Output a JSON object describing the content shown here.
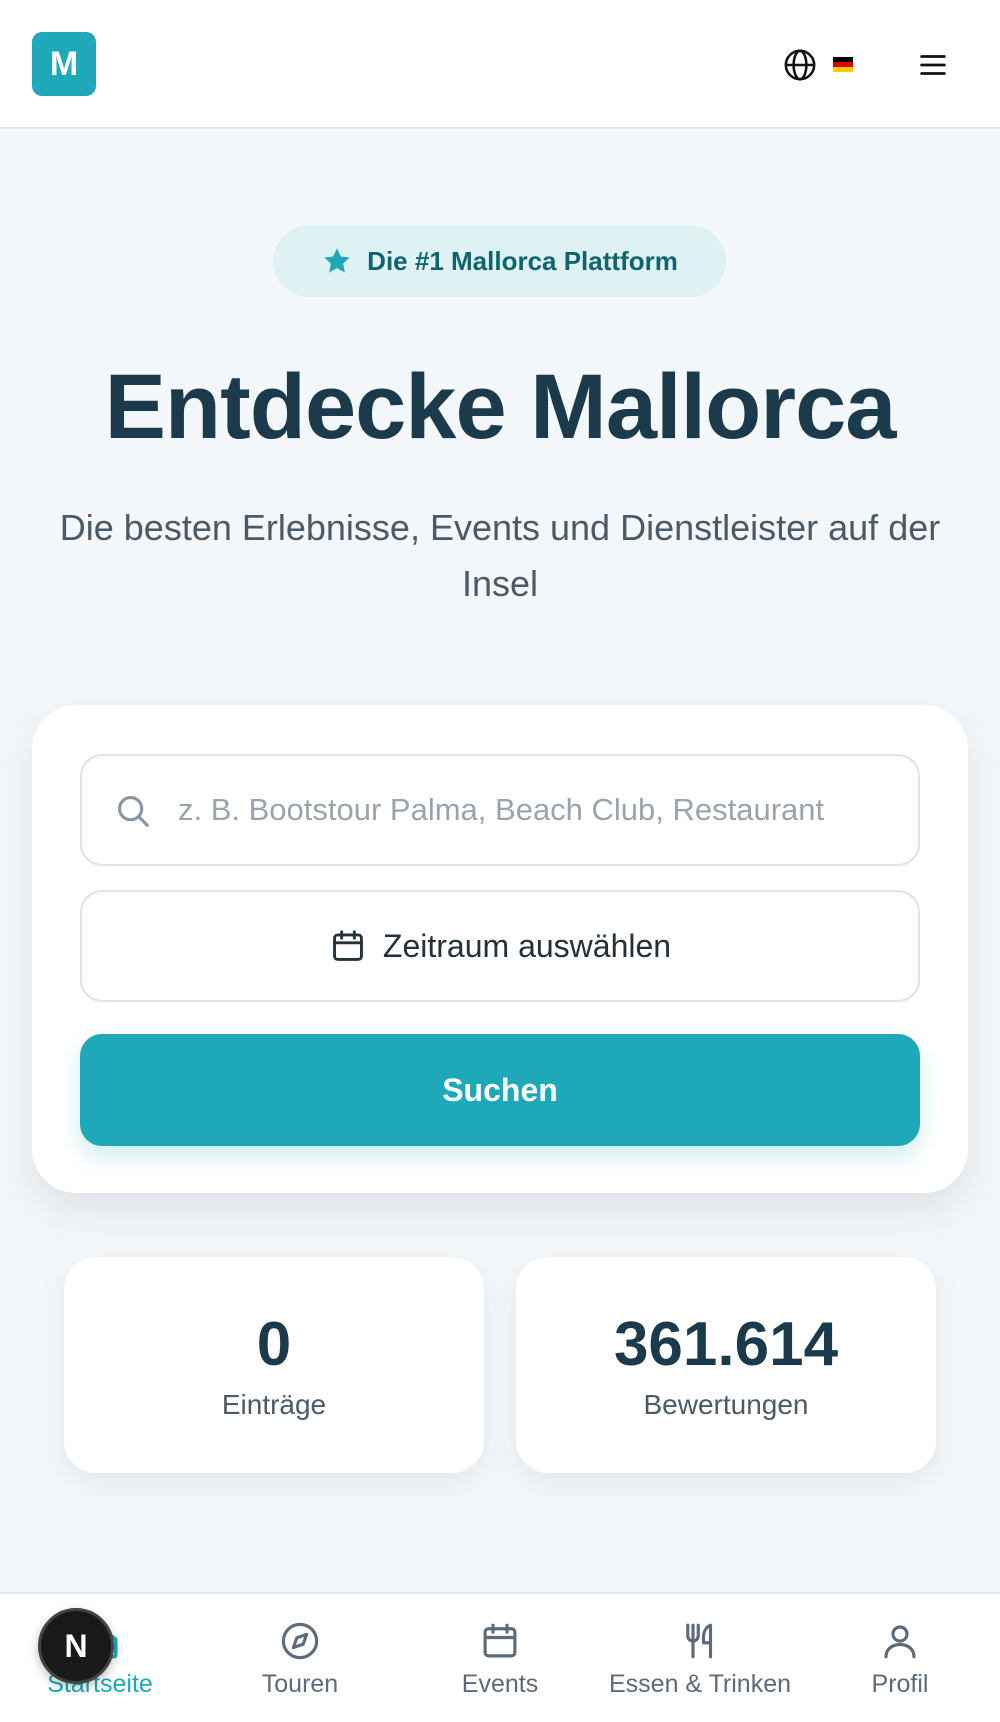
{
  "header": {
    "logo_letter": "M",
    "language_flag": "de",
    "icons": {
      "language": "globe-icon",
      "menu": "menu-icon"
    }
  },
  "hero": {
    "badge_text": "Die #1 Mallorca Plattform",
    "title": "Entdecke Mallorca",
    "subtitle": "Die besten Erlebnisse, Events und Dienstleister auf der Insel"
  },
  "search": {
    "placeholder": "z. B. Bootstour Palma, Beach Club, Restaurant",
    "value": "",
    "date_label": "Zeitraum auswählen",
    "submit_label": "Suchen"
  },
  "stats": [
    {
      "value": "0",
      "label": "Einträge"
    },
    {
      "value": "361.614",
      "label": "Bewertungen"
    }
  ],
  "bottom_nav": {
    "items": [
      {
        "label": "Startseite",
        "icon": "home-icon",
        "active": true
      },
      {
        "label": "Touren",
        "icon": "compass-icon",
        "active": false
      },
      {
        "label": "Events",
        "icon": "calendar-icon",
        "active": false
      },
      {
        "label": "Essen & Trinken",
        "icon": "utensils-icon",
        "active": false
      },
      {
        "label": "Profil",
        "icon": "user-icon",
        "active": false
      }
    ]
  },
  "dev_badge_letter": "N",
  "colors": {
    "accent": "#1fa8b7",
    "text_dark": "#1b3a4b",
    "badge_bg": "#dff2f3",
    "background": "#f4f7f9"
  }
}
